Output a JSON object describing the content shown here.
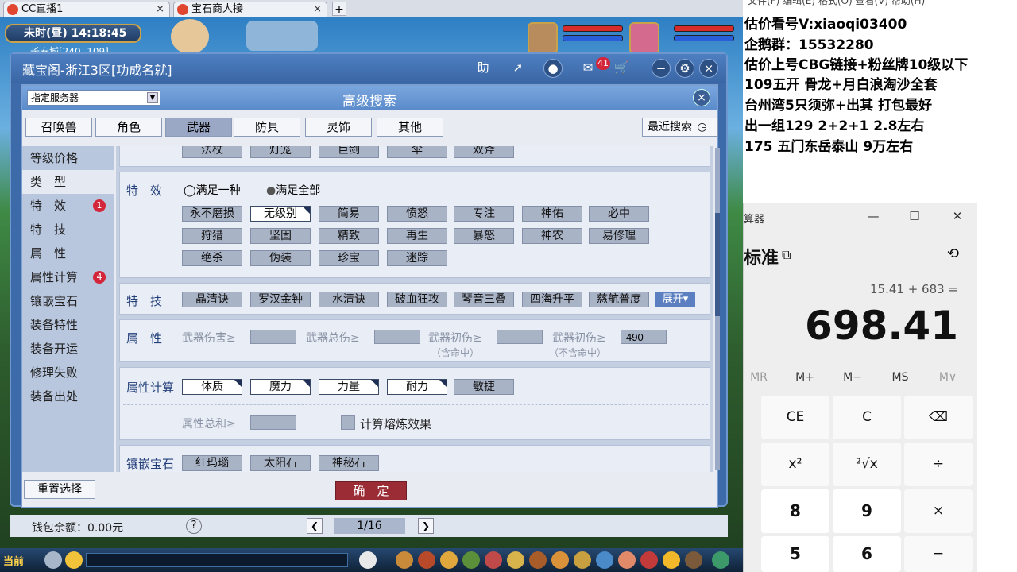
{
  "browser_tabs": [
    {
      "label": "CC直播1",
      "close": "×"
    },
    {
      "label": "宝石商人接",
      "close": "×"
    }
  ],
  "new_tab": "+",
  "game": {
    "time": "未时(昼)  14:18:45",
    "location": "长安城[240, 109]"
  },
  "window": {
    "title": "藏宝阁-浙江3区[功成名就]",
    "help": "助",
    "message_count": "41"
  },
  "panel": {
    "server_select": "指定服务器",
    "title": "高级搜索",
    "close": "×",
    "tabs": [
      "召唤兽",
      "角色",
      "武器",
      "防具",
      "灵饰",
      "其他"
    ],
    "active_tab": 2,
    "recent_search": "最近搜索"
  },
  "side_nav": [
    {
      "label": "等级价格"
    },
    {
      "label": "类　型",
      "active": true
    },
    {
      "label": "特　效",
      "badge": "1"
    },
    {
      "label": "特　技"
    },
    {
      "label": "属　性"
    },
    {
      "label": "属性计算",
      "badge": "4"
    },
    {
      "label": "镶嵌宝石"
    },
    {
      "label": "装备特性"
    },
    {
      "label": "装备开运"
    },
    {
      "label": "修理失败"
    },
    {
      "label": "装备出处"
    }
  ],
  "weapon_types": [
    "法杖",
    "灯笼",
    "巨剑",
    "伞",
    "双斧"
  ],
  "effects": {
    "label": "特　效",
    "radio_any": "满足一种",
    "radio_all": "满足全部",
    "options": [
      "永不磨损",
      "无级别",
      "简易",
      "愤怒",
      "专注",
      "神佑",
      "必中",
      "狩猎",
      "坚固",
      "精致",
      "再生",
      "暴怒",
      "神农",
      "易修理",
      "绝杀",
      "伪装",
      "珍宝",
      "迷踪"
    ]
  },
  "skills": {
    "label": "特　技",
    "options": [
      "晶清诀",
      "罗汉金钟",
      "水清诀",
      "破血狂攻",
      "琴音三叠",
      "四海升平",
      "慈航普度"
    ],
    "expand": "展开"
  },
  "attributes": {
    "label": "属　性",
    "fields": [
      {
        "label": "武器伤害≥",
        "value": "",
        "hint": ""
      },
      {
        "label": "武器总伤≥",
        "value": "",
        "hint": ""
      },
      {
        "label": "武器初伤≥",
        "value": "",
        "hint": "（含命中）"
      },
      {
        "label": "武器初伤≥",
        "value": "490",
        "hint": "（不含命中）"
      }
    ]
  },
  "attr_calc": {
    "label": "属性计算",
    "options": [
      "体质",
      "魔力",
      "力量",
      "耐力",
      "敏捷"
    ],
    "sum_label": "属性总和≥",
    "smelt_label": "计算熔炼效果"
  },
  "gems": {
    "label": "镶嵌宝石",
    "options": [
      "红玛瑙",
      "太阳石",
      "神秘石"
    ]
  },
  "reset_button": "重置选择",
  "confirm_button": "确　定",
  "wallet": "钱包余额：0.00元",
  "help_q": "?",
  "page": "1/16",
  "game_chat": "当前",
  "right_menu": "文件(F)    编辑(E)    格式(O)    查看(V)    帮助(H)",
  "notes": [
    "估价看号V:xiaoqi03400",
    "企鹅群：15532280",
    "估价上号CBG链接+粉丝牌10级以下",
    "109五开 骨龙+月白浪淘沙全套",
    "台州湾5只须弥+出其 打包最好",
    "出一组129 2+2+1    2.8左右",
    "175 五门东岳泰山  9万左右"
  ],
  "calculator": {
    "title": "算器",
    "mode": "标准",
    "expression": "15.41 + 683 =",
    "display": "698.41",
    "memory": [
      "MR",
      "M+",
      "M−",
      "MS",
      "M∨"
    ],
    "keys": [
      "CE",
      "C",
      "⌫",
      "x²",
      "²√x",
      "÷",
      "8",
      "9",
      "×",
      "5",
      "6",
      "−"
    ]
  }
}
